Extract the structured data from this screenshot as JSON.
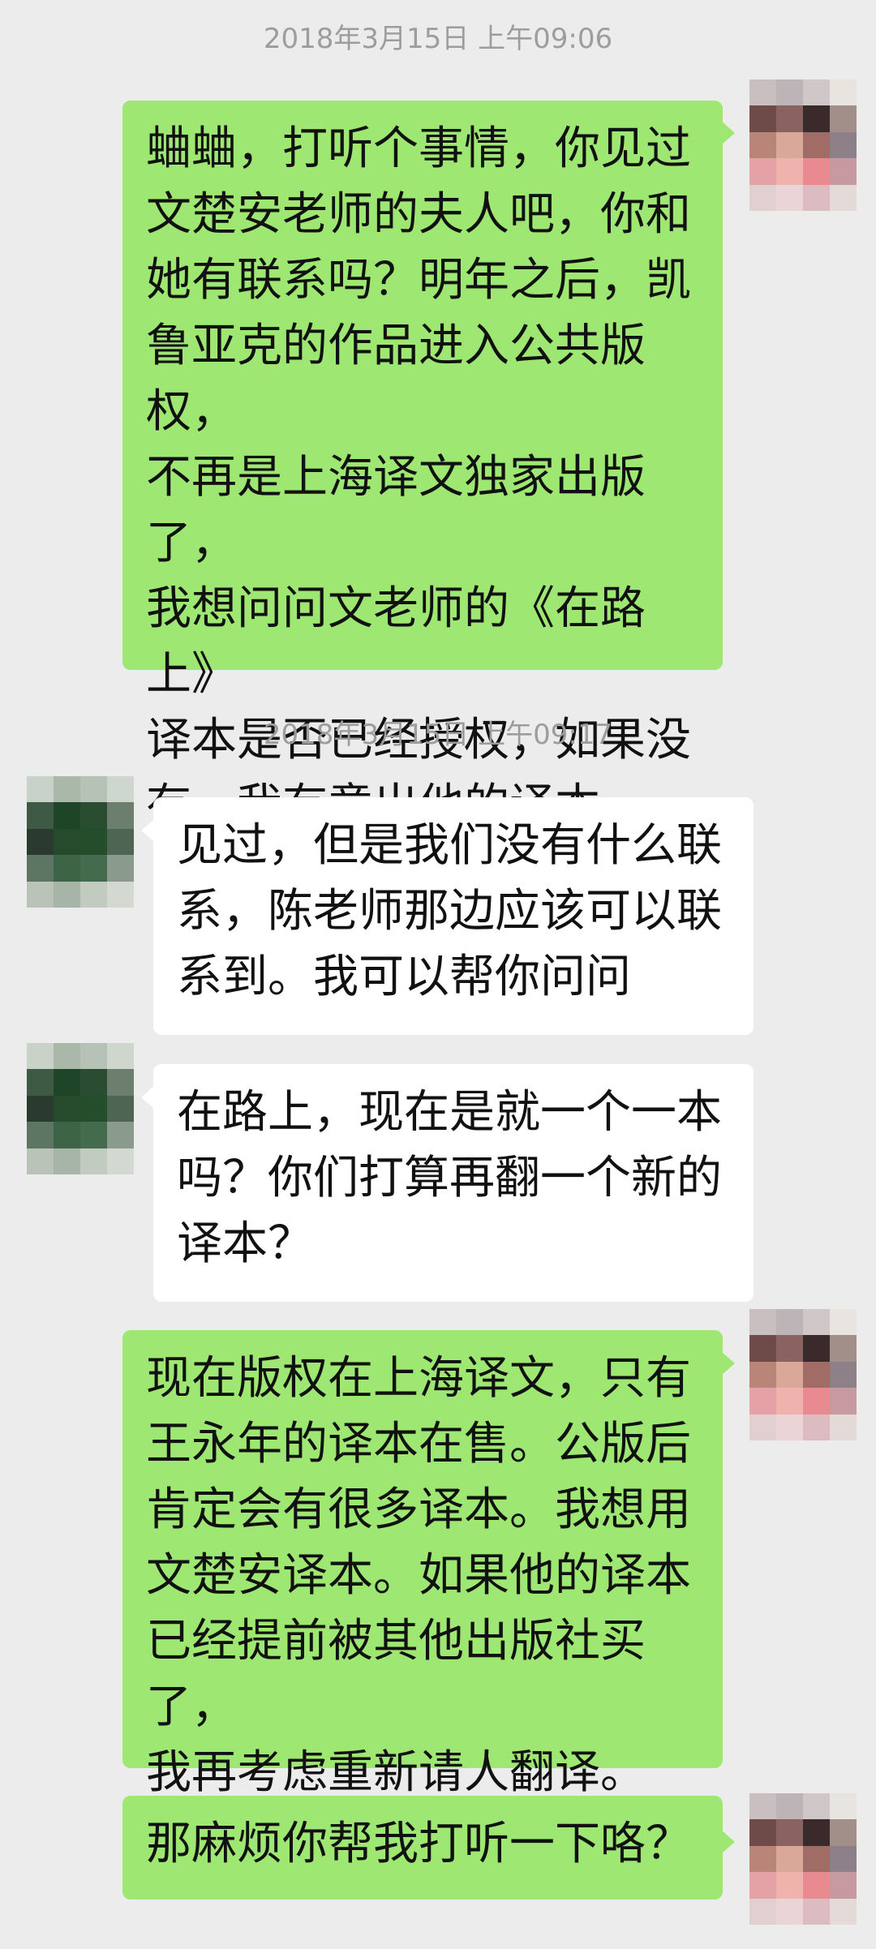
{
  "colors": {
    "background": "#ececec",
    "sent_bubble": "#9de772",
    "received_bubble": "#ffffff",
    "timestamp": "#9d9d9d"
  },
  "timestamps": [
    "2018年3月15日 上午09:06",
    "2018年3月15日 上午09:17"
  ],
  "messages": [
    {
      "sender": "me",
      "text": "蛐蛐，打听个事情，你见过\n文楚安老师的夫人吧，你和\n她有联系吗？明年之后，凯\n鲁亚克的作品进入公共版权，\n不再是上海译文独家出版了，\n我想问问文老师的《在路上》\n译本是否已经授权，如果没\n有，我有意出他的译本。"
    },
    {
      "sender": "other",
      "text": "见过，但是我们没有什么联\n系，陈老师那边应该可以联\n系到。我可以帮你问问"
    },
    {
      "sender": "other",
      "text": "在路上，现在是就一个一本\n吗？你们打算再翻一个新的\n译本？"
    },
    {
      "sender": "me",
      "text": "现在版权在上海译文，只有\n王永年的译本在售。公版后\n肯定会有很多译本。我想用\n文楚安译本。如果他的译本\n已经提前被其他出版社买了，\n我再考虑重新请人翻译。"
    },
    {
      "sender": "me",
      "text": "那麻烦你帮我打听一下咯？"
    }
  ],
  "avatars": {
    "me": "pixelated-avatar-me",
    "other": "pixelated-avatar-contact"
  }
}
